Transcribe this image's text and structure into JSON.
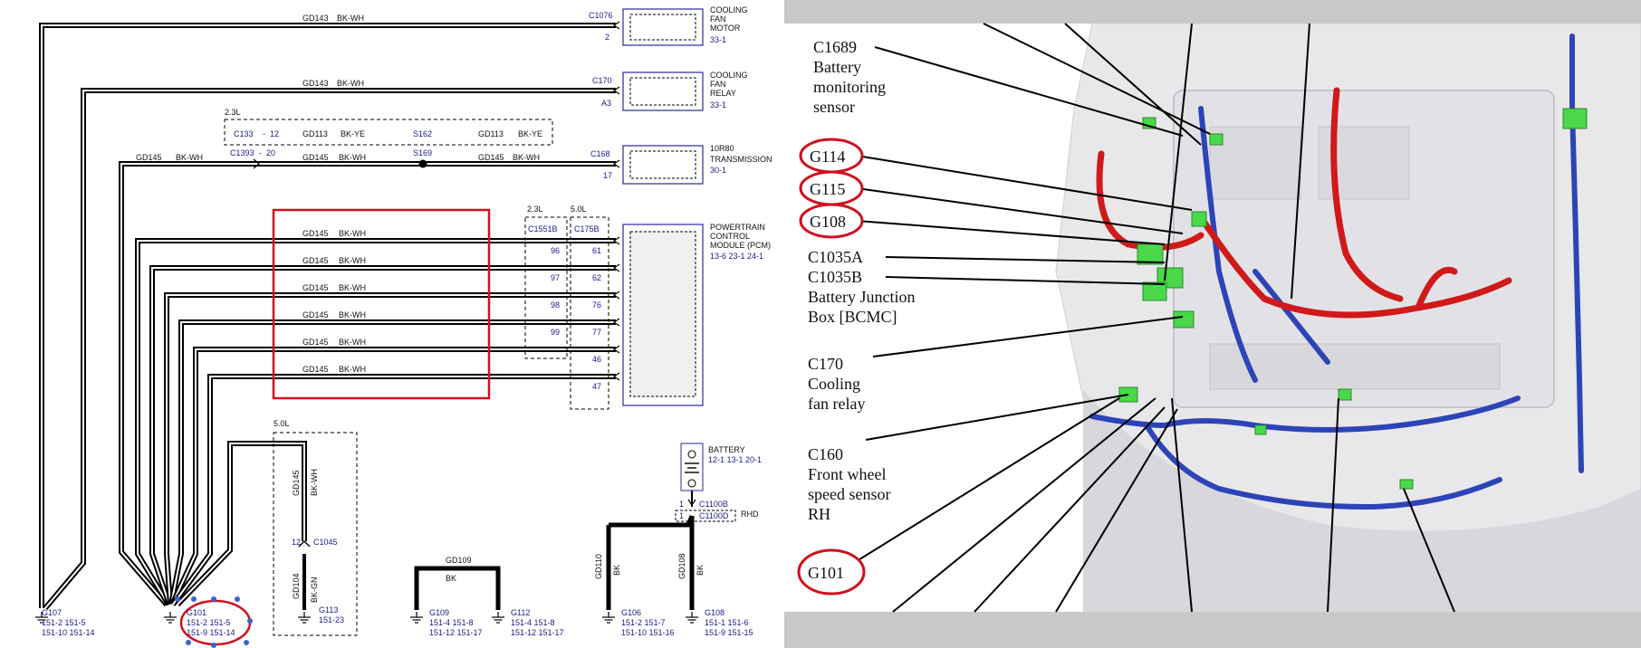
{
  "wiring": {
    "components": [
      {
        "id": "c1076",
        "connector": "C1076",
        "pin": "2",
        "name": [
          "COOLING",
          "FAN",
          "MOTOR"
        ],
        "ref": "33-1"
      },
      {
        "id": "c170",
        "connector": "C170",
        "pin": "A3",
        "name": [
          "COOLING",
          "FAN",
          "RELAY"
        ],
        "ref": "33-1"
      },
      {
        "id": "c168",
        "connector": "C168",
        "pin": "17",
        "name": [
          "10R80",
          "TRANSMISSION"
        ],
        "ref": "30-1"
      },
      {
        "id": "pcm",
        "connector": "",
        "pin": "",
        "name": [
          "POWERTRAIN",
          "CONTROL",
          "MODULE (PCM)"
        ],
        "ref": "13-6    23-1\n24-1"
      }
    ],
    "top_wires": [
      {
        "circuit": "GD143",
        "color": "BK-WH"
      },
      {
        "circuit": "GD143",
        "color": "BK-WH"
      }
    ],
    "variant_23": "2.3L",
    "variant_50": "5.0L",
    "alt_path": {
      "c133": "C133",
      "c133_pin": "12",
      "c1": "GD113",
      "c1_color": "BK-YE",
      "splice": "S162",
      "c2": "GD113",
      "c2_color": "BK-YE"
    },
    "trans_path": {
      "c_left": "GD145",
      "c_left_color": "BK-WH",
      "c1393": "C1393",
      "c1393_pin": "20",
      "c1": "GD145",
      "c1_color": "BK-WH",
      "splice": "S169",
      "c2": "GD145",
      "c2_color": "BK-WH"
    },
    "pcm_wires": [
      {
        "circuit": "GD145",
        "color": "BK-WH",
        "pin23": "96",
        "pin50": "61"
      },
      {
        "circuit": "GD145",
        "color": "BK-WH",
        "pin23": "97",
        "pin50": "62"
      },
      {
        "circuit": "GD145",
        "color": "BK-WH",
        "pin23": "98",
        "pin50": "76"
      },
      {
        "circuit": "GD145",
        "color": "BK-WH",
        "pin23": "99",
        "pin50": "77"
      },
      {
        "circuit": "GD145",
        "color": "BK-WH",
        "pin23": "",
        "pin50": "46"
      },
      {
        "circuit": "GD145",
        "color": "BK-WH",
        "pin23": "",
        "pin50": "47"
      }
    ],
    "pcm_conn_23": "C1551B",
    "pcm_conn_50": "C175B",
    "c1045": {
      "circuit_top": "GD145",
      "color_top": "BK-WH",
      "pin": "12",
      "connector": "C1045",
      "circuit_bottom": "GD104",
      "color_bottom": "BK-GN",
      "ground": "G113",
      "ref": "151-23"
    },
    "gd109": {
      "circuit": "GD109",
      "color": "BK"
    },
    "battery": {
      "label": "BATTERY",
      "refs": "12-1    13-1\n20-1",
      "pin": "1",
      "conn1": "C1100B",
      "conn2": "C1100D",
      "rhd": "RHD"
    },
    "gd110": {
      "circuit": "GD110",
      "color": "BK"
    },
    "gd108": {
      "circuit": "GD108",
      "color": "BK"
    },
    "grounds": [
      {
        "id": "G107",
        "refs": [
          "151-2    151-5",
          "151-10   151-14"
        ]
      },
      {
        "id": "G101",
        "refs": [
          "151-2    151-5",
          "151-9     151-14"
        ]
      },
      {
        "id": "G109",
        "refs": [
          "151-4    151-8",
          "151-12   151-17"
        ]
      },
      {
        "id": "G112",
        "refs": [
          "151-4    151-8",
          "151-12   151-17"
        ]
      },
      {
        "id": "G106",
        "refs": [
          "151-2    151-7",
          "151-10   151-16"
        ]
      },
      {
        "id": "G108",
        "refs": [
          "151-1    151-6",
          "151-9     151-15"
        ]
      }
    ],
    "highlight_color": "#d0101e"
  },
  "photo": {
    "callouts": [
      {
        "lines": [
          "C1689",
          "Battery",
          "monitoring",
          "sensor"
        ],
        "circled": false
      },
      {
        "lines": [
          "G114"
        ],
        "circled": true
      },
      {
        "lines": [
          "G115"
        ],
        "circled": true
      },
      {
        "lines": [
          "G108"
        ],
        "circled": true
      },
      {
        "lines": [
          "C1035A"
        ],
        "circled": false
      },
      {
        "lines": [
          "C1035B",
          "Battery Junction",
          "Box [BCMC]"
        ],
        "circled": false
      },
      {
        "lines": [
          "C170",
          "Cooling",
          "fan relay"
        ],
        "circled": false
      },
      {
        "lines": [
          "C160",
          "Front wheel",
          "speed sensor",
          "RH"
        ],
        "circled": false
      },
      {
        "lines": [
          "G101"
        ],
        "circled": true
      }
    ],
    "circle_color": "#d0101e",
    "harness_red": "#d01a1a",
    "harness_blue": "#2d44b8",
    "connector_green": "#4ad84a"
  }
}
